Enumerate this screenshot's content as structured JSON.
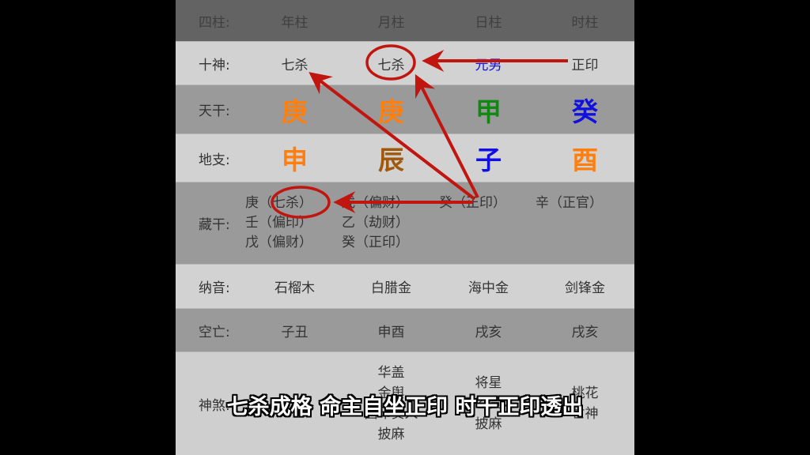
{
  "header": {
    "label": "四柱:",
    "cols": [
      "年柱",
      "月柱",
      "日柱",
      "时柱"
    ]
  },
  "shishen": {
    "label": "十神:",
    "cols": [
      "七杀",
      "七杀",
      "元男",
      "正印"
    ]
  },
  "tiangan": {
    "label": "天干:",
    "cols": [
      {
        "char": "庚",
        "color": "#ff7f0e"
      },
      {
        "char": "庚",
        "color": "#ff7f0e"
      },
      {
        "char": "甲",
        "color": "#118811"
      },
      {
        "char": "癸",
        "color": "#1010e0"
      }
    ]
  },
  "dizhi": {
    "label": "地支:",
    "cols": [
      {
        "char": "申",
        "color": "#ff7f0e"
      },
      {
        "char": "辰",
        "color": "#a0580a"
      },
      {
        "char": "子",
        "color": "#1010e0"
      },
      {
        "char": "酉",
        "color": "#ff7f0e"
      }
    ]
  },
  "canggan": {
    "label": "藏干:",
    "cols": [
      [
        "庚（七杀）",
        "壬（偏印）",
        "戊（偏财）"
      ],
      [
        "戊（偏财）",
        "乙（劫财）",
        "癸（正印）"
      ],
      [
        "癸（正印）"
      ],
      [
        "辛（正官）"
      ]
    ]
  },
  "nayin": {
    "label": "纳音:",
    "cols": [
      "石榴木",
      "白腊金",
      "海中金",
      "剑锋金"
    ]
  },
  "kongwang": {
    "label": "空亡:",
    "cols": [
      "子丑",
      "申酉",
      "戌亥",
      "戌亥"
    ]
  },
  "shensha": {
    "label": "神煞:",
    "cols": [
      [],
      [
        "华盖",
        "金舆",
        "国印贵人",
        "披麻"
      ],
      [
        "将星",
        "天乙贵人",
        "披麻"
      ],
      [
        "桃花",
        "亡神"
      ]
    ]
  },
  "annotations": {
    "color": "#c0160f"
  },
  "subtitle": "七杀成格  命主自坐正印  时干正印透出"
}
